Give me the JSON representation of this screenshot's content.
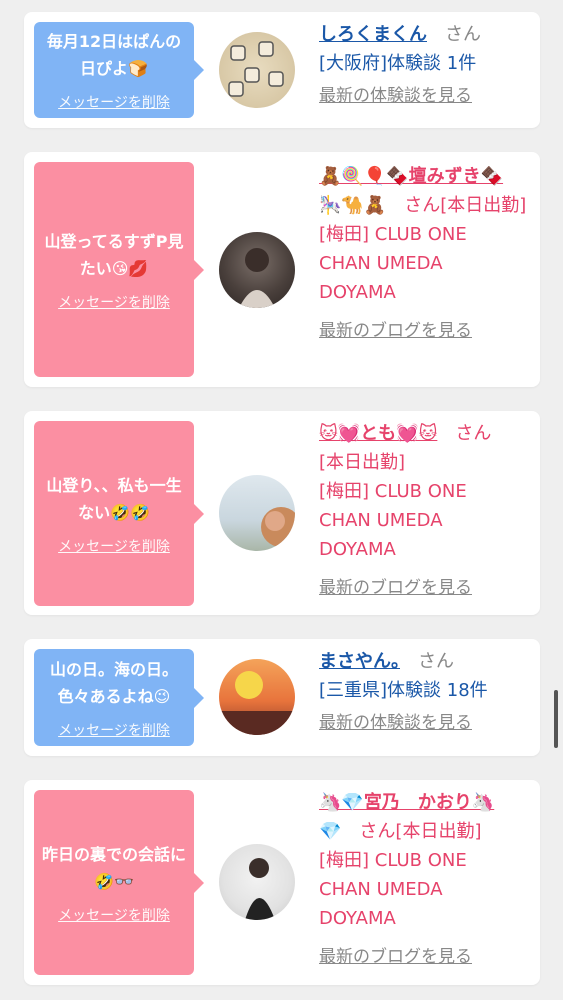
{
  "cards": [
    {
      "message": "毎月12日はぱんの日ぴよ🍞",
      "delete_label": "メッセージを削除",
      "name": "しろくまくん",
      "honorific": "さん",
      "detail_line1": "[大阪府]体験談 1件",
      "link": "最新の体験談を見る"
    },
    {
      "message": "山登ってるすずP見たい😘💋",
      "delete_label": "メッセージを削除",
      "name": "🧸🍭🎈🍫壇みずき🍫",
      "name_line2": "🎠🐪🧸",
      "honorific_status": "さん[本日出勤]",
      "shop_line1": "[梅田] CLUB ONE",
      "shop_line2": "CHAN UMEDA",
      "shop_line3": "DOYAMA",
      "link": "最新のブログを見る"
    },
    {
      "message": "山登り、、私も一生ない🤣🤣",
      "delete_label": "メッセージを削除",
      "name": "🐱💓とも💓🐱",
      "honorific": "さん",
      "status": "[本日出勤]",
      "shop_line1": "[梅田] CLUB ONE",
      "shop_line2": "CHAN UMEDA",
      "shop_line3": "DOYAMA",
      "link": "最新のブログを見る"
    },
    {
      "message": "山の日。海の日。色々あるよね😉",
      "delete_label": "メッセージを削除",
      "name": "まさやん。",
      "honorific": "さん",
      "detail_line1": "[三重県]体験談 18件",
      "link": "最新の体験談を見る"
    },
    {
      "message": "昨日の裏での会話に🤣👓",
      "delete_label": "メッセージを削除",
      "name": "🦄💎宮乃　かおり🦄",
      "name_line2": "💎",
      "honorific_status": "さん[本日出勤]",
      "shop_line1": "[梅田] CLUB ONE",
      "shop_line2": "CHAN UMEDA",
      "shop_line3": "DOYAMA",
      "link": "最新のブログを見る"
    }
  ],
  "colors": {
    "bubble_blue": "#80b4f5",
    "bubble_pink": "#fb8fa2",
    "name_blue": "#1b58a8",
    "name_pink": "#e6436b"
  }
}
